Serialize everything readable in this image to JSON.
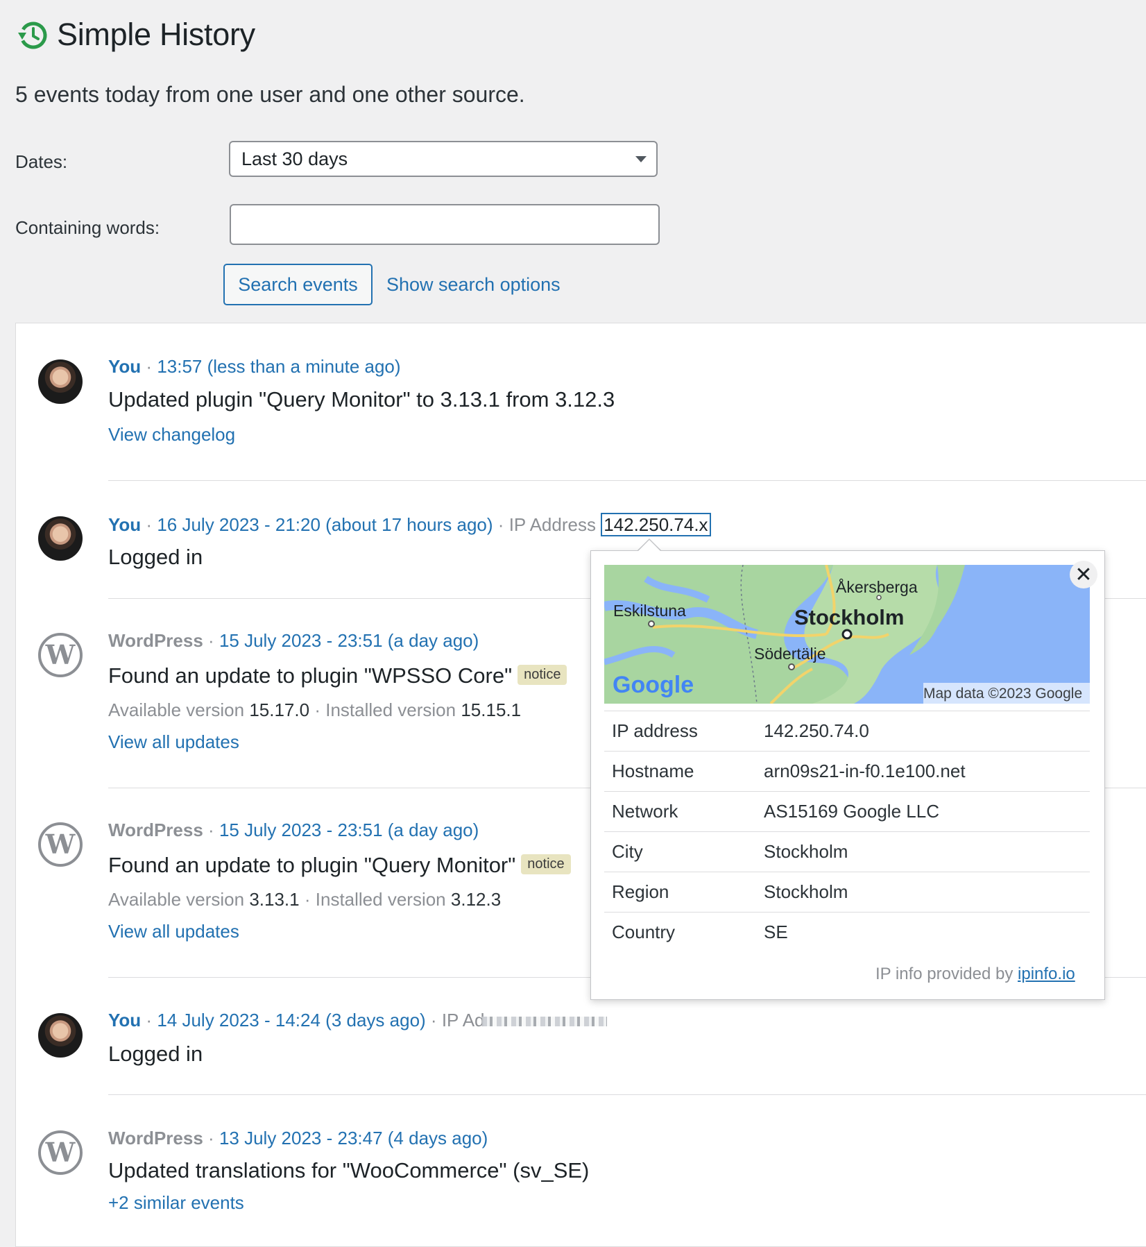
{
  "header": {
    "title": "Simple History",
    "summary": "5 events today from one user and one other source."
  },
  "filters": {
    "dates_label": "Dates:",
    "dates_value": "Last 30 days",
    "words_label": "Containing words:",
    "words_value": "",
    "search_button": "Search events",
    "show_options": "Show search options"
  },
  "events": [
    {
      "who": "You",
      "when": "13:57 (less than a minute ago)",
      "message": "Updated plugin \"Query Monitor\" to 3.13.1 from 3.12.3",
      "action": "View changelog"
    },
    {
      "who": "You",
      "when": "16 July 2023 - 21:20 (about 17 hours ago)",
      "ip_label": "IP Address",
      "ip": "142.250.74.x",
      "message": "Logged in"
    },
    {
      "who": "WordPress",
      "when": "15 July 2023 - 23:51 (a day ago)",
      "message": "Found an update to plugin \"WPSSO Core\"",
      "badge": "notice",
      "available_label": "Available version",
      "available": "15.17.0",
      "installed_label": "Installed version",
      "installed": "15.15.1",
      "action": "View all updates"
    },
    {
      "who": "WordPress",
      "when": "15 July 2023 - 23:51 (a day ago)",
      "message": "Found an update to plugin \"Query Monitor\"",
      "badge": "notice",
      "available_label": "Available version",
      "available": "3.13.1",
      "installed_label": "Installed version",
      "installed": "3.12.3",
      "action": "View all updates"
    },
    {
      "who": "You",
      "when": "14 July 2023 - 14:24 (3 days ago)",
      "ip_label": "IP Ad",
      "message": "Logged in"
    },
    {
      "who": "WordPress",
      "when": "13 July 2023 - 23:47 (4 days ago)",
      "message": "Updated translations for \"WooCommerce\" (sv_SE)",
      "action": "+2 similar events"
    }
  ],
  "separator": "·",
  "popover": {
    "map": {
      "cities": [
        "Åkersberga",
        "Eskilstuna",
        "Stockholm",
        "Södertälje"
      ],
      "logo": "Google",
      "attribution": "Map data ©2023 Google"
    },
    "close": "✕",
    "rows": [
      {
        "key": "IP address",
        "value": "142.250.74.0"
      },
      {
        "key": "Hostname",
        "value": "arn09s21-in-f0.1e100.net"
      },
      {
        "key": "Network",
        "value": "AS15169 Google LLC"
      },
      {
        "key": "City",
        "value": "Stockholm"
      },
      {
        "key": "Region",
        "value": "Stockholm"
      },
      {
        "key": "Country",
        "value": "SE"
      }
    ],
    "footer_prefix": "IP info provided by",
    "footer_link": "ipinfo.io"
  },
  "colors": {
    "link": "#2271b1",
    "history_icon": "#2b9a4a",
    "notice_bg": "#e8e4c0",
    "map_water": "#8ab4f8",
    "map_land": "#a8d5a0"
  },
  "icons": {
    "history": "history-icon",
    "wordpress": "wordpress-logo-icon",
    "close": "close-icon"
  }
}
